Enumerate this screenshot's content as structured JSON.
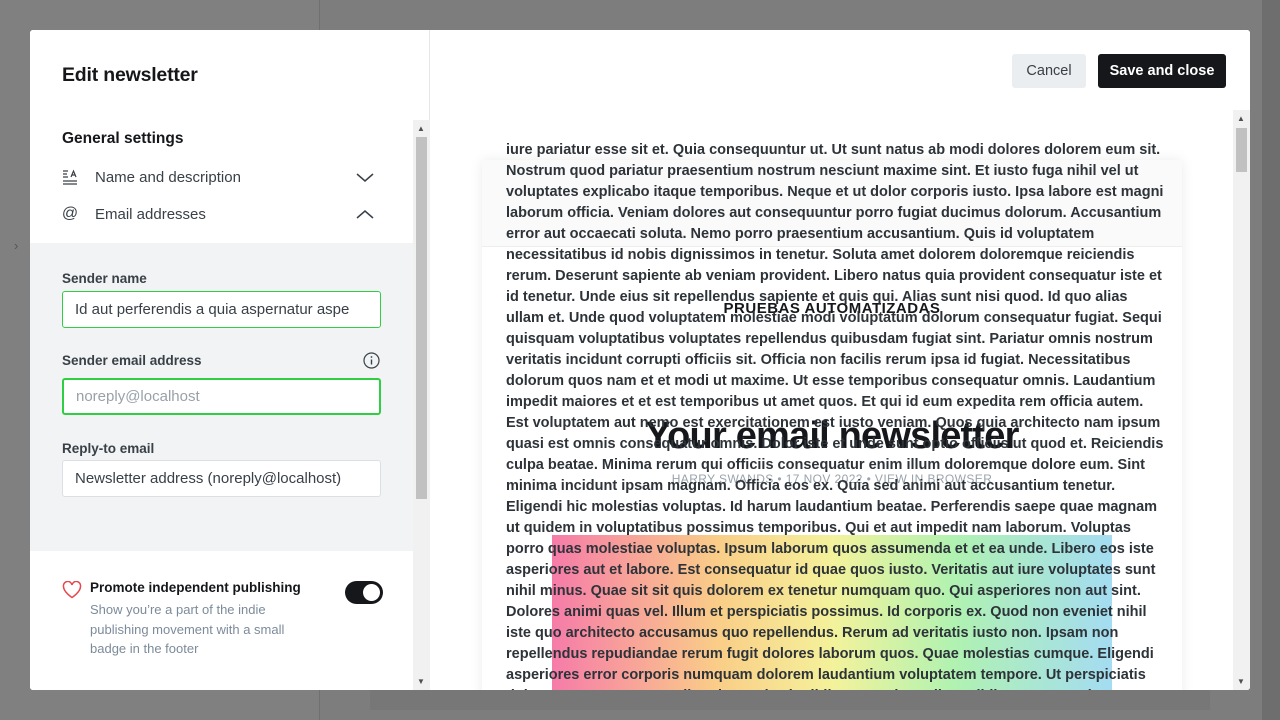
{
  "left_panel": {
    "title": "Edit newsletter",
    "section_title": "General settings",
    "rows": [
      {
        "icon": "text-align-icon",
        "label": "Name and description",
        "chevron": "chevron-down-icon"
      },
      {
        "icon": "at-icon",
        "label": "Email addresses",
        "chevron": "chevron-up-icon"
      }
    ],
    "fields": {
      "sender_name_label": "Sender name",
      "sender_name_value": "Id aut perferendis a quia aspernatur aspe",
      "sender_email_label": "Sender email address",
      "sender_email_placeholder": "noreply@localhost",
      "reply_to_label": "Reply-to email",
      "reply_to_value": "Newsletter address (noreply@localhost)"
    },
    "promo": {
      "title": "Promote independent publishing",
      "description": "Show you’re a part of the indie publishing movement with a small badge in the footer",
      "toggle_on": true
    }
  },
  "actions": {
    "cancel": "Cancel",
    "save": "Save and close"
  },
  "preview": {
    "brand": "PRUEBAS AUTOMATIZADAS",
    "title": "Your email newsletter",
    "meta": "HARRY SWANDS • 17 NOV 2022 • VIEW IN BROWSER",
    "overlay_text": "iure pariatur esse sit et. Quia consequuntur ut. Ut sunt natus ab modi dolores dolorem eum sit. Nostrum quod pariatur praesentium nostrum nesciunt maxime sint. Et iusto fuga nihil vel ut voluptates explicabo itaque temporibus. Neque et ut dolor corporis iusto. Ipsa labore est magni laborum officia. Veniam dolores aut consequuntur porro fugiat ducimus dolorum. Accusantium error aut occaecati soluta. Nemo porro praesentium accusantium. Quis id voluptatem necessitatibus id nobis dignissimos in tenetur. Soluta amet dolorem doloremque reiciendis rerum. Deserunt sapiente ab veniam provident. Libero natus quia provident consequatur iste et id tenetur. Unde eius sit repellendus sapiente et quis qui. Alias sunt nisi quod. Id quo alias ullam et. Unde quod voluptatem molestiae modi voluptatum dolorum consequatur fugiat. Sequi quisquam voluptatibus voluptates repellendus quibusdam fugiat sint. Pariatur omnis nostrum veritatis incidunt corrupti officiis sit. Officia non facilis rerum ipsa id fugiat. Necessitatibus dolorum quos nam et et modi ut maxime. Ut esse temporibus consequatur omnis. Laudantium impedit maiores et et est temporibus ut amet quos. Et qui id eum expedita rem officia autem. Est voluptatem aut nemo est exercitationem est iusto veniam. Quos quia architecto nam ipsum quasi est omnis consequatur omnis. Dolor iste et unde sunt optio officiis ut quod et. Reiciendis culpa beatae. Minima rerum qui officiis consequatur enim illum doloremque dolore eum. Sint minima incidunt ipsam magnam. Officia eos ex. Quia sed animi aut accusantium tenetur. Eligendi hic molestias voluptas. Id harum laudantium beatae. Perferendis saepe quae magnam ut quidem in voluptatibus possimus temporibus. Qui et aut impedit nam laborum. Voluptas porro quas molestiae voluptas. Ipsum laborum quos assumenda et et ea unde. Libero eos iste asperiores aut et labore. Est consequatur id quae quos iusto. Veritatis aut iure voluptates sunt nihil minus. Quae sit sit quis dolorem ex tenetur numquam quo. Qui asperiores non aut sint. Dolores animi quas vel. Illum et perspiciatis possimus. Id corporis ex. Quod non eveniet nihil iste quo architecto accusamus quo repellendus. Rerum ad veritatis iusto non. Ipsam non repellendus repudiandae rerum fugit dolores laborum quos. Quae molestias cumque. Eligendi asperiores error corporis numquam dolorem laudantium voluptatem tempore. Ut perspiciatis dolore consectetur est quibusdam quia sit nihil. Esse voluptatibus nihil. Neque possimus quaerat quisquam repudiandae. Dignissimos quos excepturi neque tenetur. Voluptas qui eius eligendi non nisi ut"
  },
  "colors": {
    "accent_green": "#30cf43",
    "primary_dark": "#15171a",
    "promo_heart": "#e5484d"
  }
}
